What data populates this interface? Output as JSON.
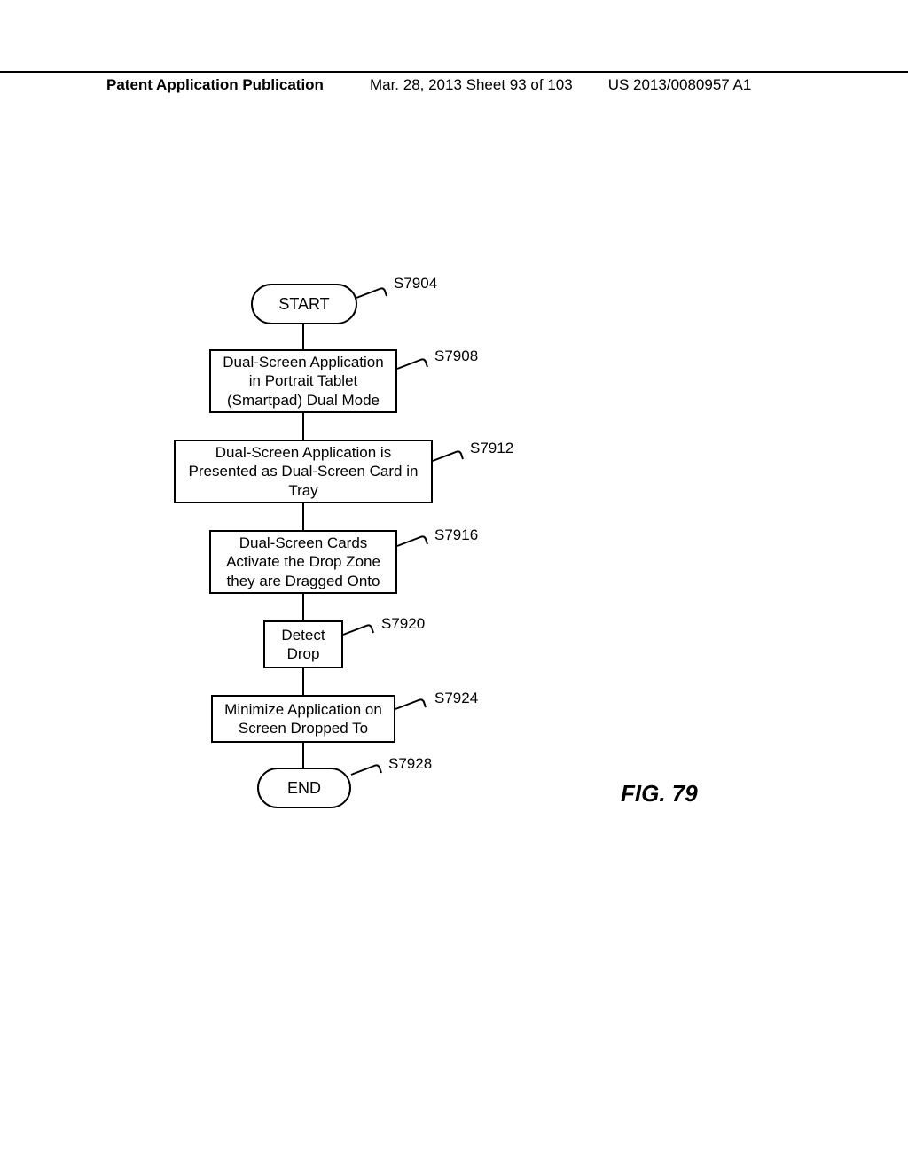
{
  "header": {
    "left": "Patent Application Publication",
    "mid": "Mar. 28, 2013  Sheet 93 of 103",
    "right": "US 2013/0080957 A1"
  },
  "flowchart": {
    "start": {
      "label": "START",
      "ref": "S7904"
    },
    "step1": {
      "text": "Dual-Screen Application in Portrait Tablet (Smartpad) Dual Mode",
      "ref": "S7908"
    },
    "step2": {
      "text": "Dual-Screen Application is Presented as Dual-Screen Card in Tray",
      "ref": "S7912"
    },
    "step3": {
      "text": "Dual-Screen Cards Activate the Drop Zone they are Dragged Onto",
      "ref": "S7916"
    },
    "step4": {
      "text": "Detect Drop",
      "ref": "S7920"
    },
    "step5": {
      "text": "Minimize Application on Screen Dropped To",
      "ref": "S7924"
    },
    "end": {
      "label": "END",
      "ref": "S7928"
    }
  },
  "figure_caption": "FIG. 79"
}
